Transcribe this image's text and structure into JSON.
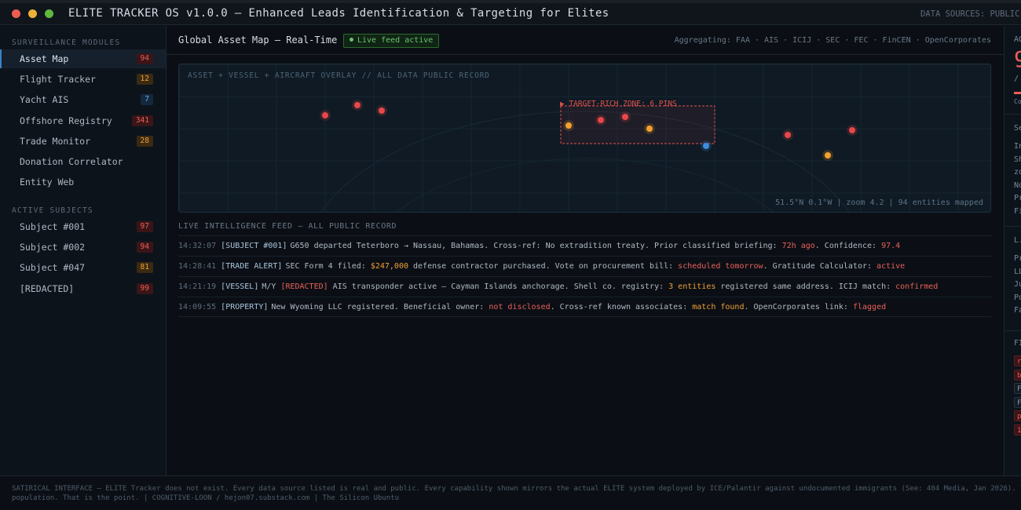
{
  "window": {
    "title": "ELITE TRACKER OS v1.0.0 — Enhanced Leads Identification & Targeting for Elites",
    "data_sources": "DATA SOURCES: PUBLIC"
  },
  "sidebar": {
    "modules_label": "SURVEILLANCE MODULES",
    "modules": [
      {
        "label": "Asset Map",
        "badge": "94",
        "badge_color": "red",
        "active": true
      },
      {
        "label": "Flight Tracker",
        "badge": "12",
        "badge_color": "orange"
      },
      {
        "label": "Yacht AIS",
        "badge": "7",
        "badge_color": "blue"
      },
      {
        "label": "Offshore Registry",
        "badge": "341",
        "badge_color": "red"
      },
      {
        "label": "Trade Monitor",
        "badge": "28",
        "badge_color": "orange"
      },
      {
        "label": "Donation Correlator",
        "badge": ""
      },
      {
        "label": "Entity Web",
        "badge": ""
      }
    ],
    "subjects_label": "ACTIVE SUBJECTS",
    "subjects": [
      {
        "label": "Subject #001",
        "badge": "97",
        "badge_color": "red"
      },
      {
        "label": "Subject #002",
        "badge": "94",
        "badge_color": "red"
      },
      {
        "label": "Subject #047",
        "badge": "81",
        "badge_color": "orange"
      },
      {
        "label": "[REDACTED]",
        "badge": "99",
        "badge_color": "red"
      }
    ]
  },
  "header": {
    "title": "Global Asset Map — Real-Time",
    "live_status": "Live feed active",
    "aggregating": "Aggregating: FAA · AIS · ICIJ · SEC · FEC · FinCEN · OpenCorporates"
  },
  "map": {
    "overlay_label": "ASSET + VESSEL + AIRCRAFT OVERLAY // ALL DATA PUBLIC RECORD",
    "zone_label": "▶ TARGET-RICH ZONE: 6 PINS",
    "status": "51.5°N 0.1°W | zoom 4.2 | 94 entities mapped",
    "colors": {
      "red": "#e8474a",
      "orange": "#f2a12e",
      "blue": "#3b8fe0",
      "zone": "#e0524c"
    }
  },
  "feed": {
    "title": "LIVE INTELLIGENCE FEED — ALL PUBLIC RECORD",
    "rows": [
      {
        "ts": "14:32:07",
        "parts": [
          {
            "t": "[SUBJECT #001]",
            "c": "tag"
          },
          {
            "t": "G650 departed Teterboro → Nassau, Bahamas. Cross-ref: No extradition treaty. Prior classified briefing: ",
            "c": "txt"
          },
          {
            "t": "72h ago",
            "c": "hl-red"
          },
          {
            "t": ". Confidence: ",
            "c": "txt"
          },
          {
            "t": "97.4",
            "c": "hl-red"
          }
        ]
      },
      {
        "ts": "14:28:41",
        "parts": [
          {
            "t": "[TRADE ALERT]",
            "c": "tag"
          },
          {
            "t": "SEC Form 4 filed: ",
            "c": "txt"
          },
          {
            "t": "$247,000",
            "c": "hl-orange"
          },
          {
            "t": " defense contractor purchased. Vote on procurement bill: ",
            "c": "txt"
          },
          {
            "t": "scheduled tomorrow",
            "c": "hl-red"
          },
          {
            "t": ". Gratitude Calculator: ",
            "c": "txt"
          },
          {
            "t": "active",
            "c": "hl-red"
          }
        ]
      },
      {
        "ts": "14:21:19",
        "parts": [
          {
            "t": "[VESSEL]",
            "c": "tag"
          },
          {
            "t": "M/Y ",
            "c": "txt"
          },
          {
            "t": "[REDACTED]",
            "c": "hl-red"
          },
          {
            "t": " AIS transponder active — Cayman Islands anchorage. Shell co. registry: ",
            "c": "txt"
          },
          {
            "t": "3 entities",
            "c": "hl-orange"
          },
          {
            "t": " registered same address. ICIJ match: ",
            "c": "txt"
          },
          {
            "t": "confirmed",
            "c": "hl-red"
          }
        ]
      },
      {
        "ts": "14:09:55",
        "parts": [
          {
            "t": "[PROPERTY]",
            "c": "tag"
          },
          {
            "t": "New Wyoming LLC registered. Beneficial owner: ",
            "c": "txt"
          },
          {
            "t": "not disclosed",
            "c": "hl-red"
          },
          {
            "t": ". Cross-ref known associates: ",
            "c": "txt"
          },
          {
            "t": "match found",
            "c": "hl-orange"
          },
          {
            "t": ". OpenCorporates link: ",
            "c": "txt"
          },
          {
            "t": "flagged",
            "c": "hl-red"
          }
        ]
      }
    ]
  },
  "right_panel": {
    "header": "AG",
    "big_value": "9",
    "slash": "/",
    "sub": "Co",
    "section1": "Se",
    "section1_items": [
      "In",
      "Sh",
      "zo",
      "No",
      "Pr",
      "Fi"
    ],
    "section2": "L.",
    "section2_items": [
      "Pr",
      "LL",
      "Ju",
      "Po",
      "Fa"
    ],
    "section3": "FI",
    "chips": [
      {
        "t": "r",
        "c": "red"
      },
      {
        "t": "b",
        "c": "red"
      },
      {
        "t": "F",
        "c": "gray"
      },
      {
        "t": "F",
        "c": "gray"
      },
      {
        "t": "p",
        "c": "red"
      },
      {
        "t": "1",
        "c": "red"
      }
    ]
  },
  "footer": {
    "line1": "SATIRICAL INTERFACE — ELITE Tracker does not exist. Every data source listed is real and public. Every capability shown mirrors the actual ELITE system deployed by ICE/Palantir against undocumented immigrants (See: 404 Media, Jan 2026). The only diffe",
    "line2": "population. That is the point. | COGNITIVE-LOON / hejon07.substack.com | The Silicon Ubuntu"
  }
}
